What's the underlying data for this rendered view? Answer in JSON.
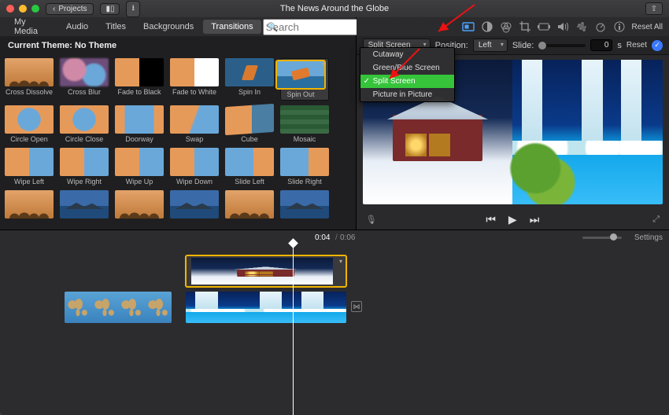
{
  "titlebar": {
    "back_label": "Projects",
    "title": "The News Around the Globe"
  },
  "tabs": {
    "items": [
      "My Media",
      "Audio",
      "Titles",
      "Backgrounds",
      "Transitions"
    ],
    "active_index": 4
  },
  "search": {
    "placeholder": "Search"
  },
  "theme_label": "Current Theme: No Theme",
  "transitions": {
    "row0": [
      {
        "label": "Cross Dissolve",
        "style": "g-trees"
      },
      {
        "label": "Cross Blur",
        "style": "g-blur"
      },
      {
        "label": "Fade to Black",
        "style": "g-ftb"
      },
      {
        "label": "Fade to White",
        "style": "g-ftw"
      },
      {
        "label": "Spin In",
        "style": "g-spin"
      },
      {
        "label": "Spin Out",
        "style": "g-spino",
        "selected": true
      }
    ],
    "row1": [
      {
        "label": "Circle Open",
        "style": "g-circ"
      },
      {
        "label": "Circle Close",
        "style": "g-circ"
      },
      {
        "label": "Doorway",
        "style": "g-door"
      },
      {
        "label": "Swap",
        "style": "g-swap"
      },
      {
        "label": "Cube",
        "style": "g-cube"
      },
      {
        "label": "Mosaic",
        "style": "g-mosaic"
      }
    ],
    "row2": [
      {
        "label": "Wipe Left",
        "style": "g-wipe"
      },
      {
        "label": "Wipe Right",
        "style": "g-wipe"
      },
      {
        "label": "Wipe Up",
        "style": "g-wipe"
      },
      {
        "label": "Wipe Down",
        "style": "g-wipe"
      },
      {
        "label": "Slide Left",
        "style": "g-slide"
      },
      {
        "label": "Slide Right",
        "style": "g-slide"
      }
    ],
    "row3": [
      {
        "label": "",
        "style": "g-trees"
      },
      {
        "label": "",
        "style": "g-lake"
      },
      {
        "label": "",
        "style": "g-trees"
      },
      {
        "label": "",
        "style": "g-lake"
      },
      {
        "label": "",
        "style": "g-trees"
      },
      {
        "label": "",
        "style": "g-lake"
      }
    ]
  },
  "inspector": {
    "reset_all": "Reset All",
    "overlay_mode": "Split Screen",
    "position_label": "Position:",
    "position_value": "Left",
    "slide_label": "Slide:",
    "slide_value": "0",
    "slide_unit": "s",
    "reset": "Reset",
    "dropdown_options": [
      "Cutaway",
      "Green/Blue Screen",
      "Split Screen",
      "Picture in Picture"
    ],
    "dropdown_selected_index": 2
  },
  "timecode": {
    "current": "0:04",
    "separator": "/",
    "duration": "0:06"
  },
  "settings_label": "Settings"
}
